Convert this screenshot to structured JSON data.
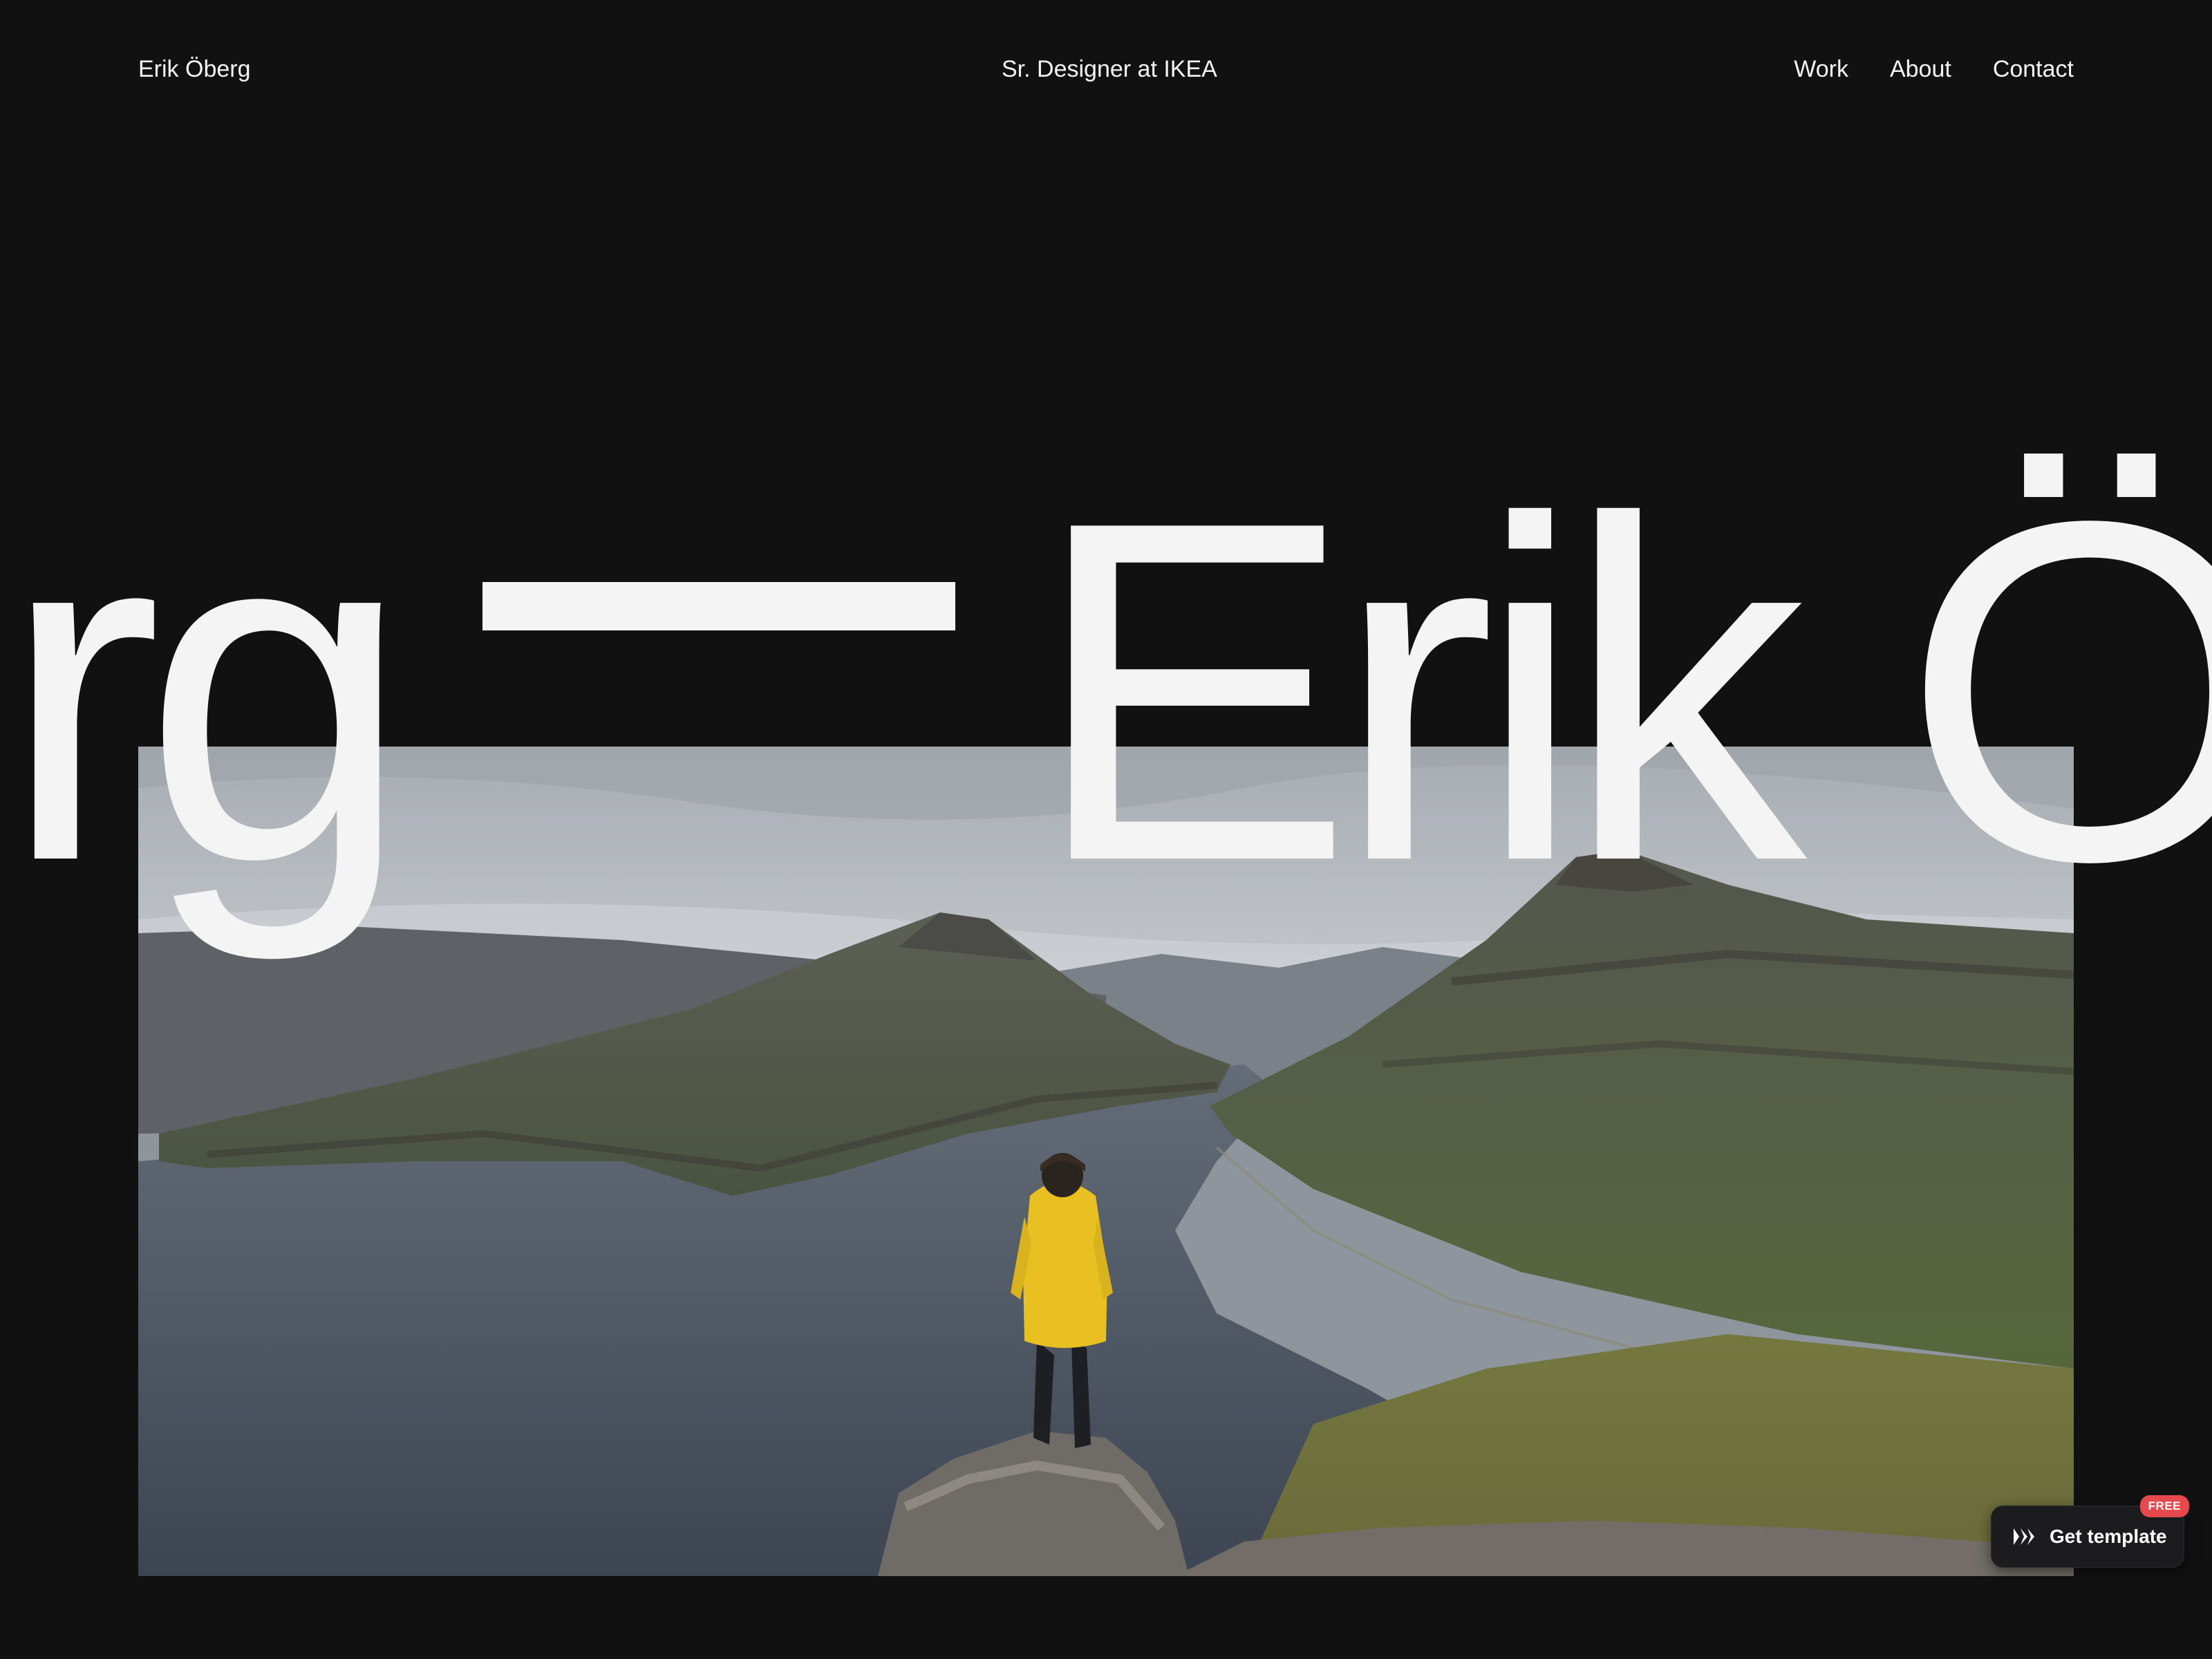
{
  "header": {
    "brand": "Erik Öberg",
    "tagline": "Sr. Designer at IKEA",
    "nav": [
      {
        "label": "Work"
      },
      {
        "label": "About"
      },
      {
        "label": "Contact"
      }
    ]
  },
  "hero": {
    "marquee_left": "erg",
    "marquee_right": "Erik Ö",
    "image_description": ""
  },
  "badge": {
    "label": "Get template",
    "tag": "FREE",
    "icon": "framer-logo-icon"
  },
  "colors": {
    "background": "#111112",
    "text": "#f4f4f4",
    "jacket": "#e8c022",
    "badge_tag": "#e5484d"
  }
}
